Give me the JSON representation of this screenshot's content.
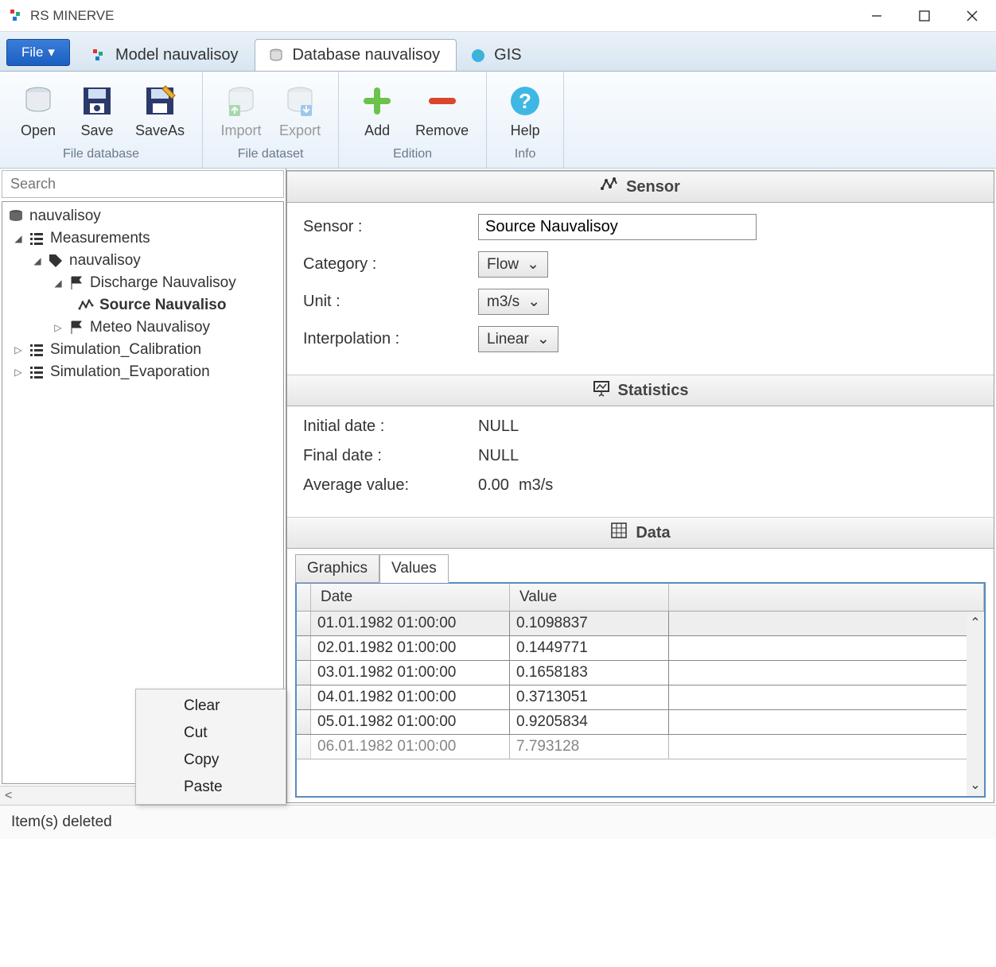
{
  "app": {
    "title": "RS MINERVE"
  },
  "window_controls": {
    "minimize": "minimize",
    "maximize": "maximize",
    "close": "close"
  },
  "file_menu": {
    "label": "File"
  },
  "tabs": [
    {
      "label": "Model nauvalisoy",
      "icon": "model-icon",
      "active": false
    },
    {
      "label": "Database nauvalisoy",
      "icon": "database-icon",
      "active": true
    },
    {
      "label": "GIS",
      "icon": "globe-icon",
      "active": false
    }
  ],
  "ribbon": {
    "groups": [
      {
        "label": "File database",
        "items": [
          {
            "label": "Open",
            "icon": "db-open-icon",
            "disabled": false
          },
          {
            "label": "Save",
            "icon": "save-icon",
            "disabled": false
          },
          {
            "label": "SaveAs",
            "icon": "saveas-icon",
            "disabled": false
          }
        ]
      },
      {
        "label": "File dataset",
        "items": [
          {
            "label": "Import",
            "icon": "db-import-icon",
            "disabled": true
          },
          {
            "label": "Export",
            "icon": "db-export-icon",
            "disabled": true
          }
        ]
      },
      {
        "label": "Edition",
        "items": [
          {
            "label": "Add",
            "icon": "plus-icon",
            "disabled": false
          },
          {
            "label": "Remove",
            "icon": "minus-icon",
            "disabled": false
          }
        ]
      },
      {
        "label": "Info",
        "items": [
          {
            "label": "Help",
            "icon": "help-icon",
            "disabled": false
          }
        ]
      }
    ]
  },
  "search": {
    "placeholder": "Search"
  },
  "tree": {
    "root": "nauvalisoy",
    "measurements_label": "Measurements",
    "station_label": "nauvalisoy",
    "discharge_label": "Discharge Nauvalisoy",
    "source_label": "Source Nauvaliso",
    "meteo_label": "Meteo Nauvalisoy",
    "sim_cal_label": "Simulation_Calibration",
    "sim_evap_label": "Simulation_Evaporation"
  },
  "context_menu": {
    "items": [
      {
        "label": "Clear"
      },
      {
        "label": "Cut"
      },
      {
        "label": "Copy"
      },
      {
        "label": "Paste"
      }
    ]
  },
  "sensor_panel": {
    "header": "Sensor",
    "sensor_label": "Sensor :",
    "sensor_value": "Source Nauvalisoy",
    "category_label": "Category :",
    "category_value": "Flow",
    "unit_label": "Unit :",
    "unit_value": "m3/s",
    "interp_label": "Interpolation :",
    "interp_value": "Linear"
  },
  "stats_panel": {
    "header": "Statistics",
    "initial_label": "Initial date :",
    "initial_value": "NULL",
    "final_label": "Final date :",
    "final_value": "NULL",
    "avg_label": "Average value:",
    "avg_value": "0.00",
    "avg_unit": "m3/s"
  },
  "data_panel": {
    "header": "Data",
    "tabs": [
      {
        "label": "Graphics",
        "active": false
      },
      {
        "label": "Values",
        "active": true
      }
    ],
    "columns": {
      "date": "Date",
      "value": "Value"
    },
    "rows": [
      {
        "date": "01.01.1982 01:00:00",
        "value": "0.1098837"
      },
      {
        "date": "02.01.1982 01:00:00",
        "value": "0.1449771"
      },
      {
        "date": "03.01.1982 01:00:00",
        "value": "0.1658183"
      },
      {
        "date": "04.01.1982 01:00:00",
        "value": "0.3713051"
      },
      {
        "date": "05.01.1982 01:00:00",
        "value": "0.9205834"
      },
      {
        "date": "06.01.1982 01:00:00",
        "value": "7.793128"
      }
    ]
  },
  "statusbar": {
    "text": "Item(s) deleted"
  }
}
